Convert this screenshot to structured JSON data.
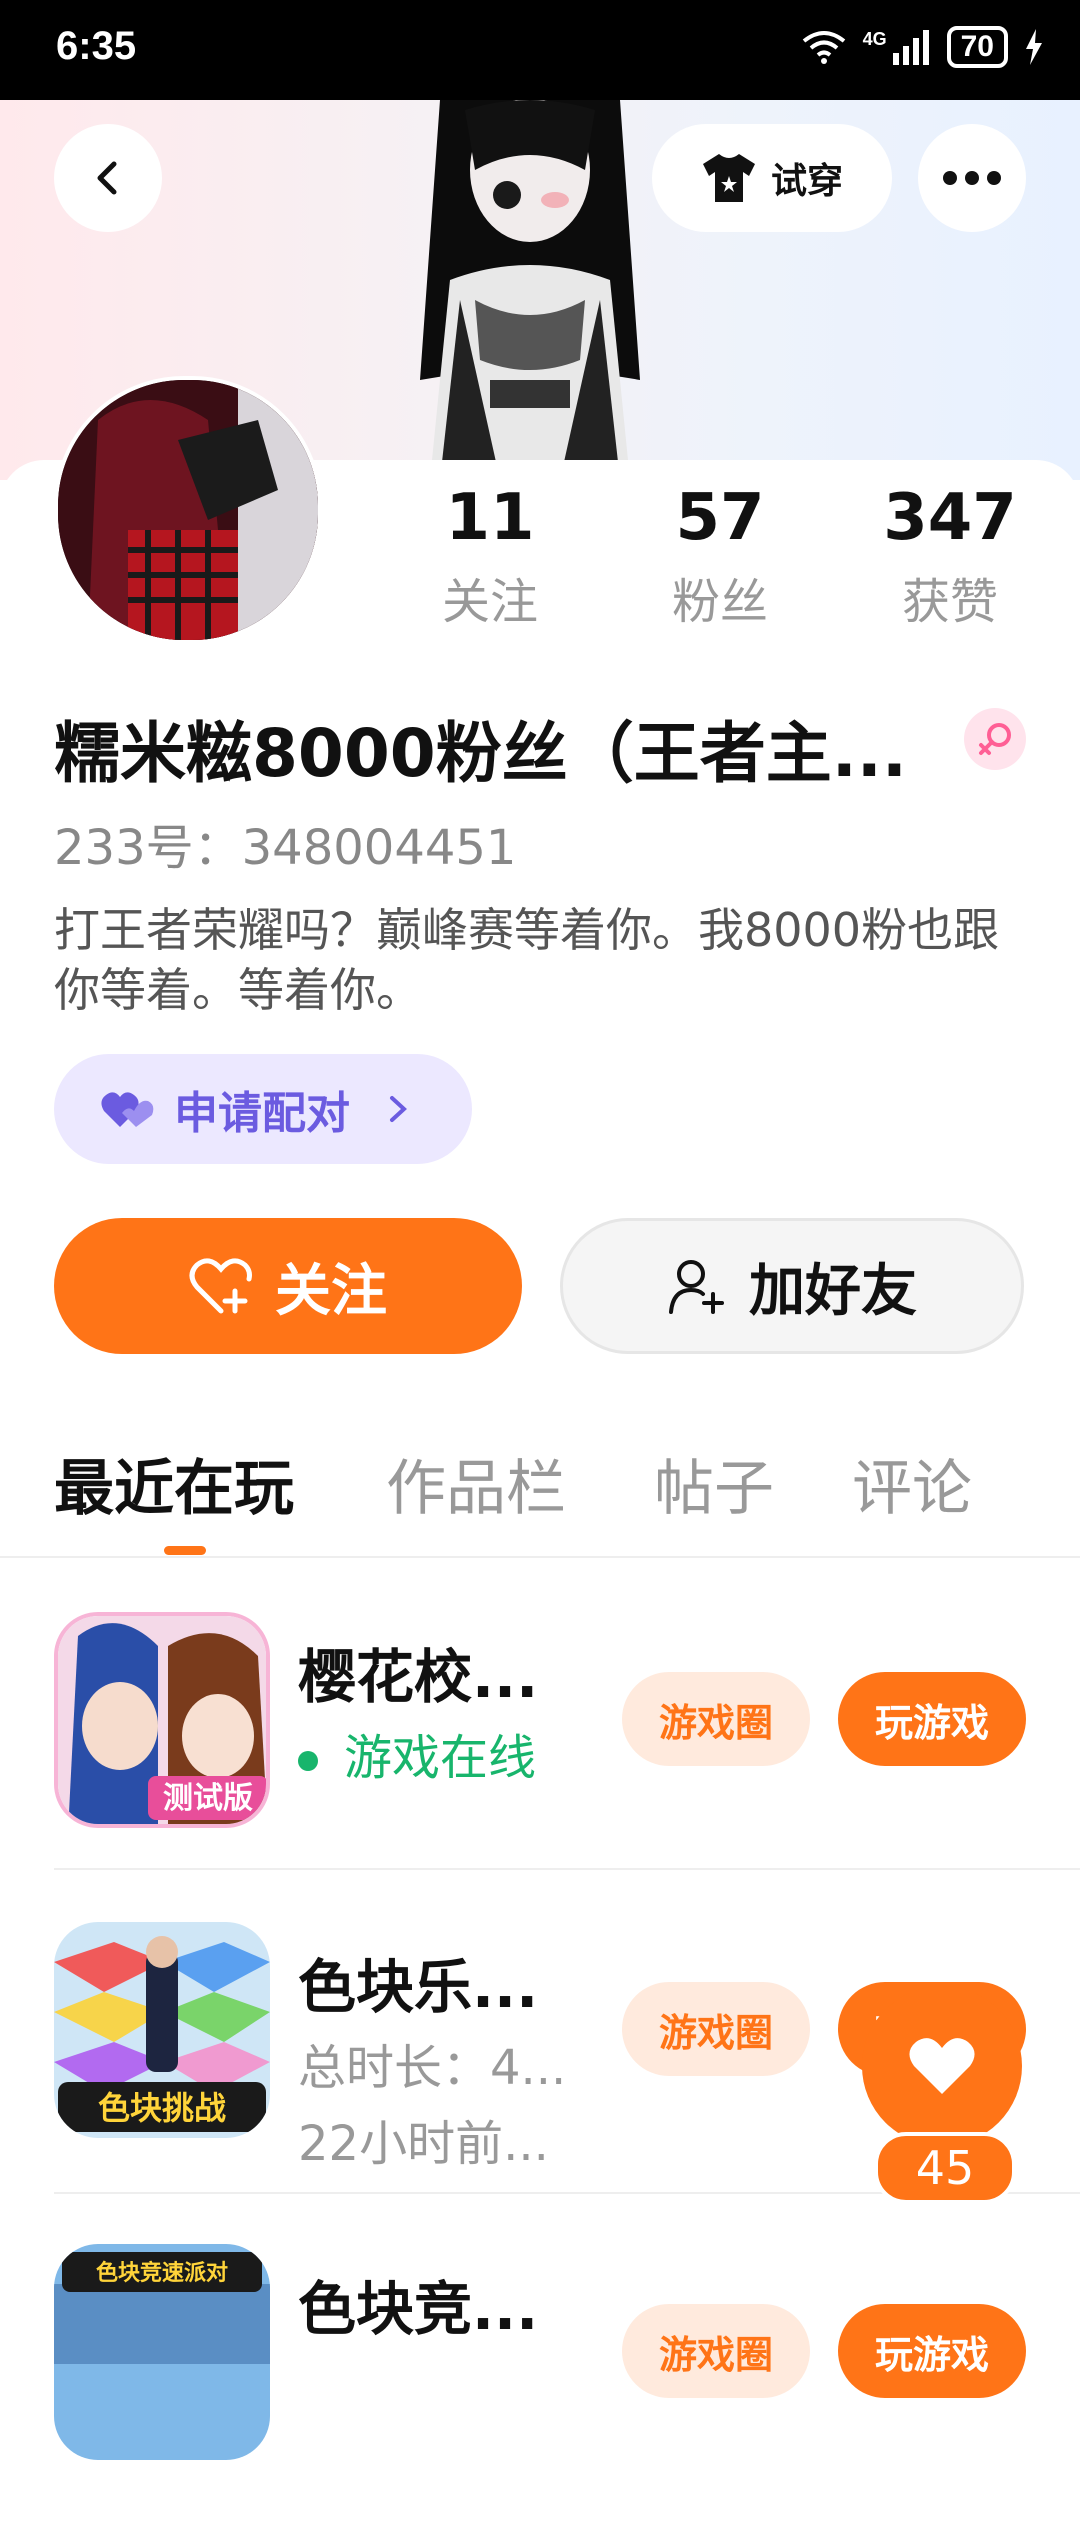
{
  "status_bar": {
    "time": "6:35",
    "network": "4G",
    "battery": "70"
  },
  "header": {
    "try_on_label": "试穿"
  },
  "stats": [
    {
      "value": "11",
      "label": "关注"
    },
    {
      "value": "57",
      "label": "粉丝"
    },
    {
      "value": "347",
      "label": "获赞"
    }
  ],
  "profile": {
    "name": "糯米糍8000粉丝（王者主...",
    "uid": "233号：348004451",
    "bio": "打王者荣耀吗？巅峰赛等着你。我8000粉也跟你等着。等着你。"
  },
  "pair_button": {
    "label": "申请配对"
  },
  "actions": {
    "follow": "关注",
    "add_friend": "加好友"
  },
  "tabs": [
    "最近在玩",
    "作品栏",
    "帖子",
    "评论"
  ],
  "games": [
    {
      "title": "樱花校...",
      "status": "游戏在线",
      "circle": "游戏圈",
      "play": "玩游戏",
      "badge": "测试版"
    },
    {
      "title": "色块乐...",
      "duration": "总时长：4...",
      "last_played": "22小时前...",
      "circle": "游戏圈",
      "play": "玩游戏",
      "badge": "色块挑战"
    },
    {
      "title": "色块竞...",
      "circle": "游戏圈",
      "play": "玩游戏",
      "badge": "色块竞速派对"
    }
  ],
  "like_fab": {
    "count": "45"
  },
  "colors": {
    "accent": "#ff7417",
    "pair": "#6b5be0",
    "online": "#18b56c"
  }
}
